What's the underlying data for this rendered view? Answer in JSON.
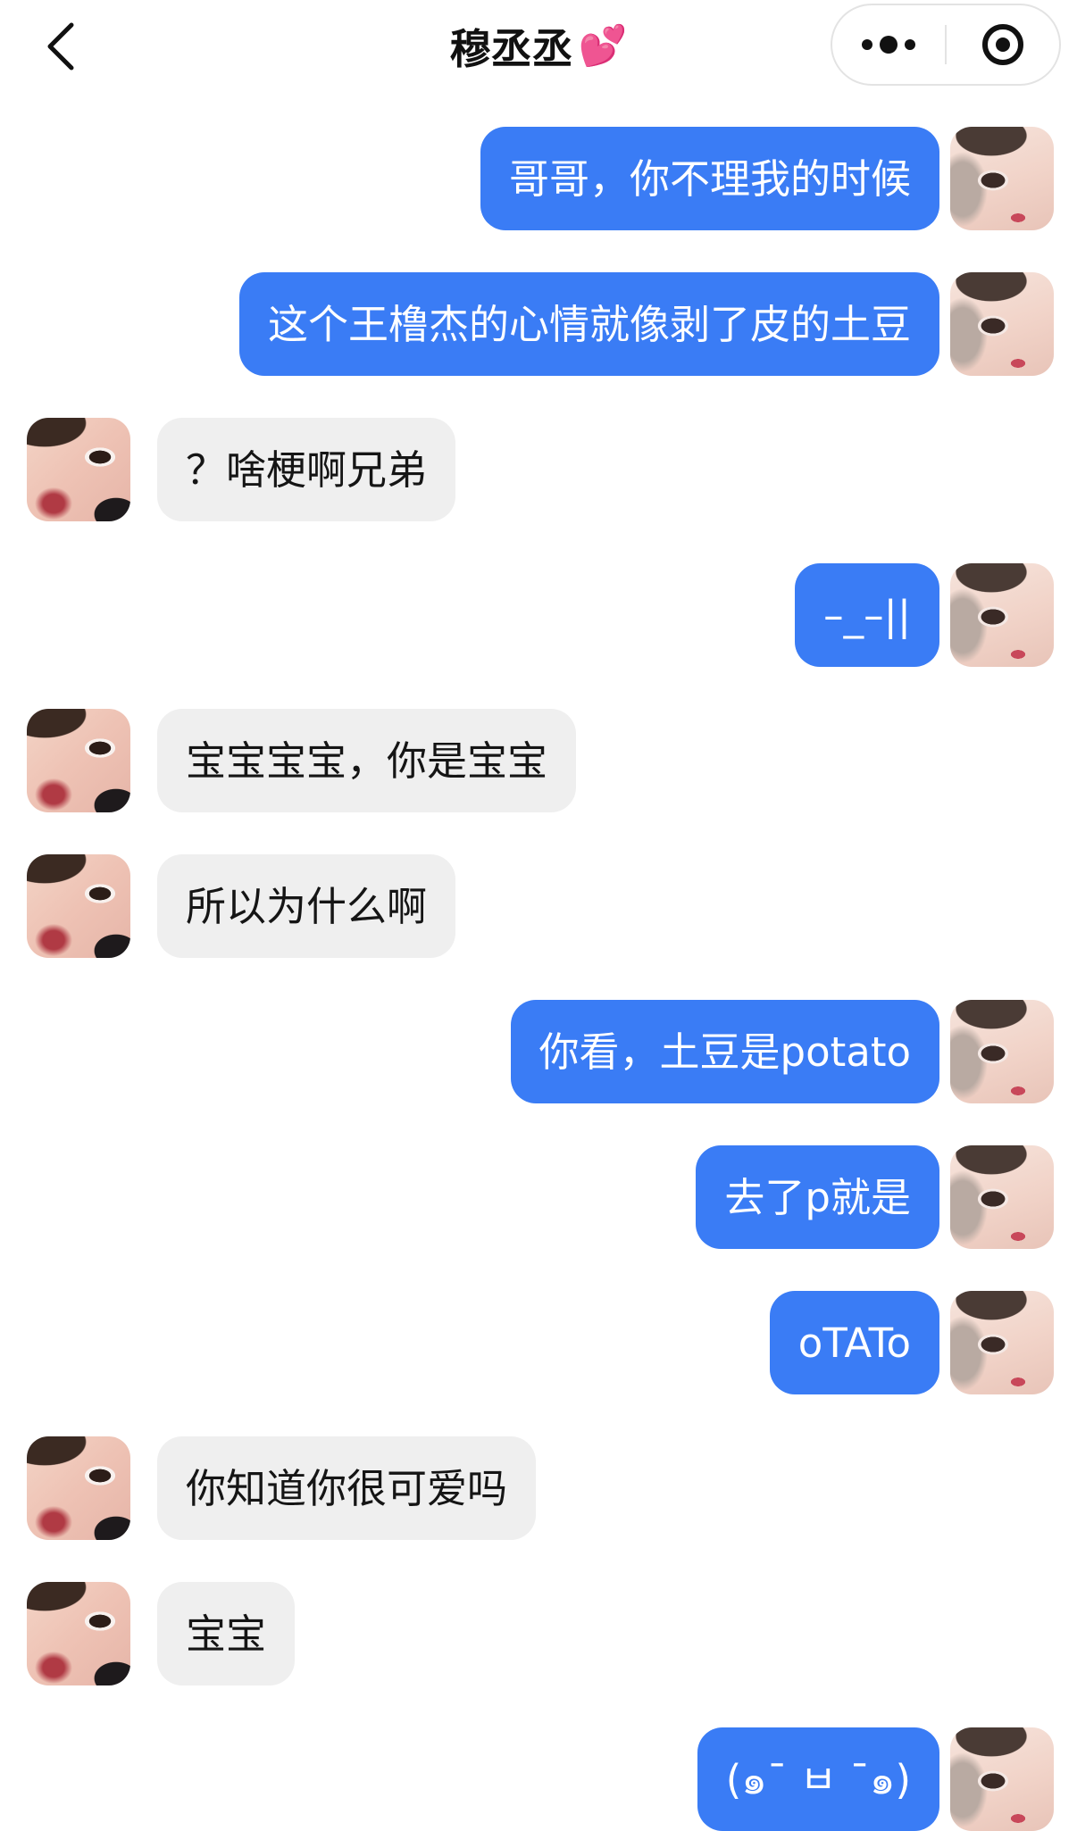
{
  "header": {
    "title": "穆丞丞",
    "title_emoji": "💕"
  },
  "colors": {
    "my_bubble": "#3a7cf5",
    "their_bubble": "#efefef",
    "my_text": "#ffffff",
    "their_text": "#151515"
  },
  "messages": [
    {
      "sender": "me",
      "text": "哥哥，你不理我的时候"
    },
    {
      "sender": "me",
      "text": "这个王橹杰的心情就像剥了皮的土豆"
    },
    {
      "sender": "them",
      "text": "？啥梗啊兄弟"
    },
    {
      "sender": "me",
      "text": "–_–||"
    },
    {
      "sender": "them",
      "text": "宝宝宝宝，你是宝宝"
    },
    {
      "sender": "them",
      "text": "所以为什么啊"
    },
    {
      "sender": "me",
      "text": "你看，土豆是potato"
    },
    {
      "sender": "me",
      "text": "去了p就是"
    },
    {
      "sender": "me",
      "text": "oTATo"
    },
    {
      "sender": "them",
      "text": "你知道你很可爱吗"
    },
    {
      "sender": "them",
      "text": "宝宝"
    },
    {
      "sender": "me",
      "text": "(๑¯ ㅂ ¯๑)"
    }
  ]
}
